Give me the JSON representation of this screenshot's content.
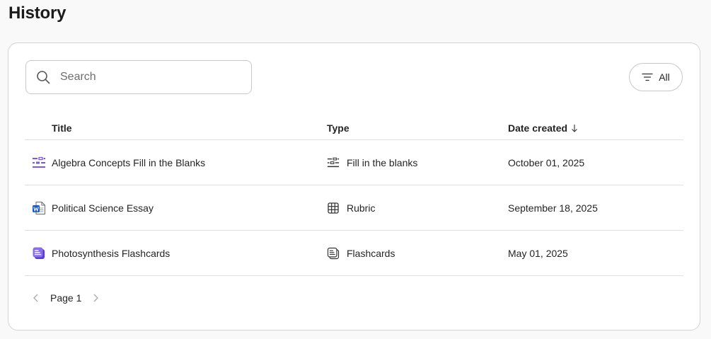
{
  "page": {
    "title": "History"
  },
  "search": {
    "placeholder": "Search",
    "value": ""
  },
  "filter": {
    "label": "All"
  },
  "table": {
    "headers": {
      "title": "Title",
      "type": "Type",
      "date": "Date created"
    },
    "rows": [
      {
        "title": "Algebra Concepts Fill in the Blanks",
        "type": "Fill in the blanks",
        "date": "October 01, 2025",
        "icon": "fill-blanks-icon"
      },
      {
        "title": "Political Science Essay",
        "type": "Rubric",
        "date": "September 18, 2025",
        "icon": "word-document-icon"
      },
      {
        "title": "Photosynthesis Flashcards",
        "type": "Flashcards",
        "date": "May 01, 2025",
        "icon": "flashcards-icon"
      }
    ]
  },
  "pagination": {
    "label": "Page 1"
  },
  "colors": {
    "accent_purple": "#7b5bd6",
    "word_blue": "#185abd"
  }
}
